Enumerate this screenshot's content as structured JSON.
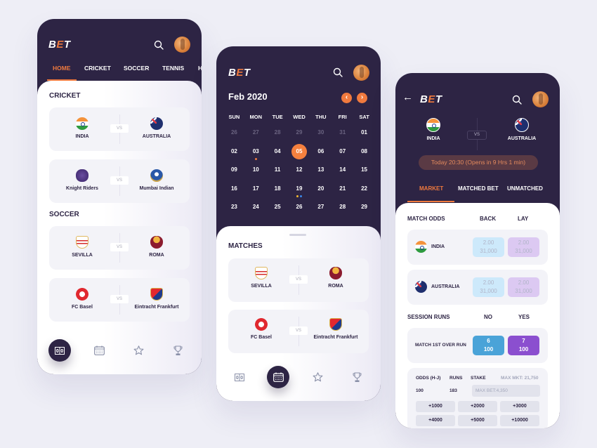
{
  "brand": {
    "prefix": "B",
    "accent": "E",
    "suffix": "T",
    "accent_color": "#f07a3e",
    "dark_color": "#2d2444"
  },
  "screen_home": {
    "tabs": [
      {
        "label": "HOME",
        "active": true
      },
      {
        "label": "CRICKET",
        "active": false
      },
      {
        "label": "SOCCER",
        "active": false
      },
      {
        "label": "TENNIS",
        "active": false
      },
      {
        "label": "H",
        "active": false
      }
    ],
    "sections": [
      {
        "title": "CRICKET",
        "matches": [
          {
            "home": "INDIA",
            "away": "AUSTRALIA",
            "vs": "VS"
          },
          {
            "home": "Knight Riders",
            "away": "Mumbai Indian",
            "vs": "VS"
          }
        ]
      },
      {
        "title": "SOCCER",
        "matches": [
          {
            "home": "SEVILLA",
            "away": "ROMA",
            "vs": "VS"
          },
          {
            "home": "FC Basel",
            "away": "Eintracht Frankfurt",
            "vs": "VS"
          }
        ]
      }
    ],
    "nav": [
      "scoreboard-icon",
      "calendar-icon",
      "star-icon",
      "trophy-icon"
    ],
    "nav_active": "scoreboard-icon"
  },
  "screen_calendar": {
    "month_label": "Feb 2020",
    "prev_label": "‹",
    "next_label": "›",
    "weekdays": [
      "SUN",
      "MON",
      "TUE",
      "WED",
      "THU",
      "FRI",
      "SAT"
    ],
    "days": [
      {
        "d": "26",
        "muted": true
      },
      {
        "d": "27",
        "muted": true
      },
      {
        "d": "28",
        "muted": true
      },
      {
        "d": "29",
        "muted": true
      },
      {
        "d": "30",
        "muted": true
      },
      {
        "d": "31",
        "muted": true
      },
      {
        "d": "01"
      },
      {
        "d": "02"
      },
      {
        "d": "03",
        "dots": [
          "#f07a3e"
        ]
      },
      {
        "d": "04"
      },
      {
        "d": "05",
        "selected": true
      },
      {
        "d": "06"
      },
      {
        "d": "07"
      },
      {
        "d": "08"
      },
      {
        "d": "09"
      },
      {
        "d": "10"
      },
      {
        "d": "11"
      },
      {
        "d": "12"
      },
      {
        "d": "13"
      },
      {
        "d": "14"
      },
      {
        "d": "15"
      },
      {
        "d": "16"
      },
      {
        "d": "17"
      },
      {
        "d": "18"
      },
      {
        "d": "19",
        "dots": [
          "#f2b830",
          "#3a86e8"
        ]
      },
      {
        "d": "20"
      },
      {
        "d": "21"
      },
      {
        "d": "22"
      },
      {
        "d": "23"
      },
      {
        "d": "24"
      },
      {
        "d": "25"
      },
      {
        "d": "26"
      },
      {
        "d": "27"
      },
      {
        "d": "28"
      },
      {
        "d": "29"
      }
    ],
    "matches_title": "MATCHES",
    "matches": [
      {
        "home": "SEVILLA",
        "away": "ROMA",
        "vs": "VS"
      },
      {
        "home": "FC Basel",
        "away": "Eintracht Frankfurt",
        "vs": "VS"
      }
    ],
    "nav_active": "calendar-icon"
  },
  "screen_market": {
    "back_label": "←",
    "home": "INDIA",
    "away": "AUSTRALIA",
    "vs": "VS",
    "time_pill": "Today 20:30 (Opens in 9 Hrs 1 min)",
    "tabs": [
      {
        "label": "MARKET",
        "active": true
      },
      {
        "label": "MATCHED BET",
        "active": false
      },
      {
        "label": "UNMATCHED",
        "active": false
      }
    ],
    "match_odds": {
      "title": "MATCH ODDS",
      "back_label": "BACK",
      "lay_label": "LAY",
      "rows": [
        {
          "team": "INDIA",
          "back_odds": "2.00",
          "back_amount": "31,000",
          "lay_odds": "2.00",
          "lay_amount": "31,000"
        },
        {
          "team": "AUSTRALIA",
          "back_odds": "2.00",
          "back_amount": "31,000",
          "lay_odds": "2.00",
          "lay_amount": "31,000"
        }
      ]
    },
    "session_runs": {
      "title": "SESSION RUNS",
      "no_label": "NO",
      "yes_label": "YES",
      "row": {
        "label": "MATCH 1ST OVER RUN",
        "no_runs": "6",
        "no_amount": "100",
        "yes_runs": "7",
        "yes_amount": "100"
      }
    },
    "stake": {
      "odds_label": "ODDS (H-J)",
      "runs_label": "RUNS",
      "stake_label": "STAKE",
      "max_mkt": "MAX MKT: 21,750",
      "odds_value": "100",
      "runs_value": "183",
      "stake_placeholder": "MAX BET:4,350",
      "chips": [
        "+1000",
        "+2000",
        "+3000",
        "+4000",
        "+5000",
        "+10000"
      ]
    }
  }
}
